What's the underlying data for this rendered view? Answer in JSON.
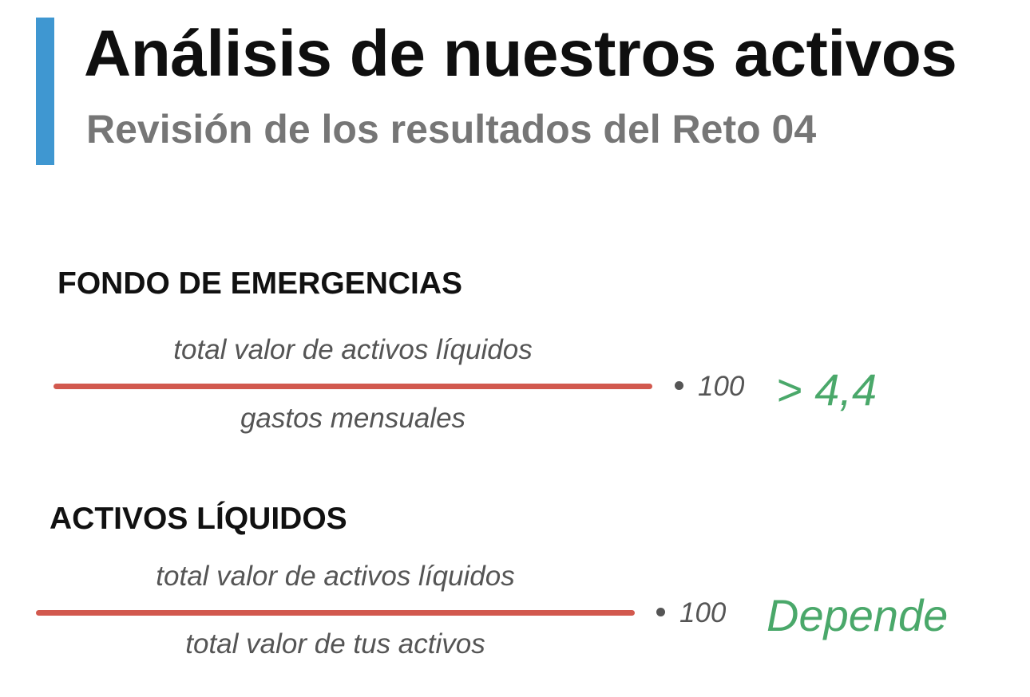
{
  "header": {
    "title": "Análisis de nuestros activos",
    "subtitle": "Revisión de los resultados del Reto 04",
    "accent_color": "#3f97d1"
  },
  "sections": [
    {
      "heading": "FONDO DE EMERGENCIAS",
      "numerator": "total valor de activos líquidos",
      "denominator": "gastos mensuales",
      "multiplier": "100",
      "result": "> 4,4"
    },
    {
      "heading": "ACTIVOS LÍQUIDOS",
      "numerator": "total valor de activos líquidos",
      "denominator": "total valor de tus activos",
      "multiplier": "100",
      "result": "Depende"
    }
  ],
  "colors": {
    "fraction_line": "#d2594e",
    "result": "#4aa86a",
    "muted_text": "#555555"
  }
}
